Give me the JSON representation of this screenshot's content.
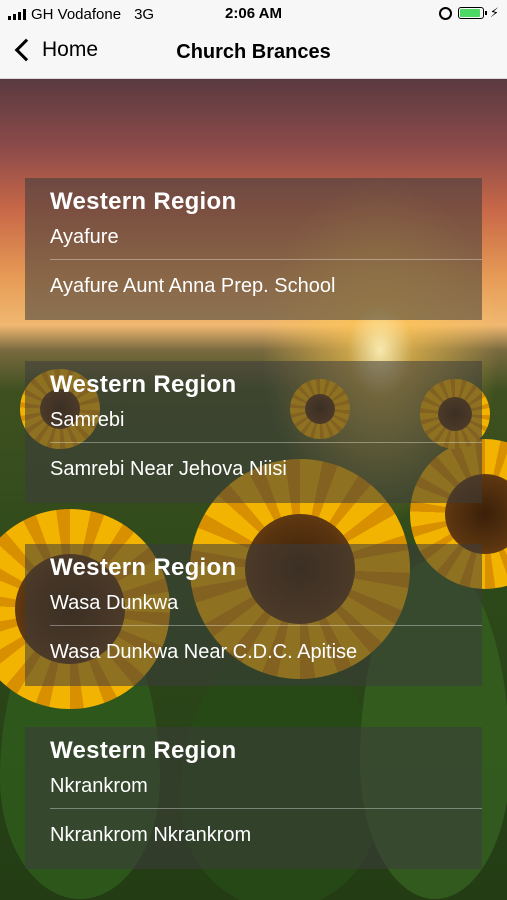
{
  "status_bar": {
    "carrier": "GH Vodafone",
    "network": "3G",
    "time": "2:06 AM"
  },
  "nav": {
    "back_label": "Home",
    "title": "Church Brances"
  },
  "branches": [
    {
      "region": "Western  Region",
      "town": "Ayafure",
      "detail": "Ayafure Aunt Anna Prep. School"
    },
    {
      "region": "Western  Region",
      "town": "Samrebi",
      "detail": "Samrebi Near Jehova Niisi"
    },
    {
      "region": "Western  Region",
      "town": "Wasa Dunkwa",
      "detail": "Wasa Dunkwa Near C.D.C. Apitise"
    },
    {
      "region": "Western  Region",
      "town": "Nkrankrom",
      "detail": "Nkrankrom Nkrankrom"
    }
  ],
  "colors": {
    "battery": "#4cd964",
    "card_overlay": "rgba(60,60,60,0.55)"
  },
  "icons": [
    "signal-icon",
    "alarm-icon",
    "battery-icon",
    "charging-icon",
    "chevron-left-icon"
  ]
}
